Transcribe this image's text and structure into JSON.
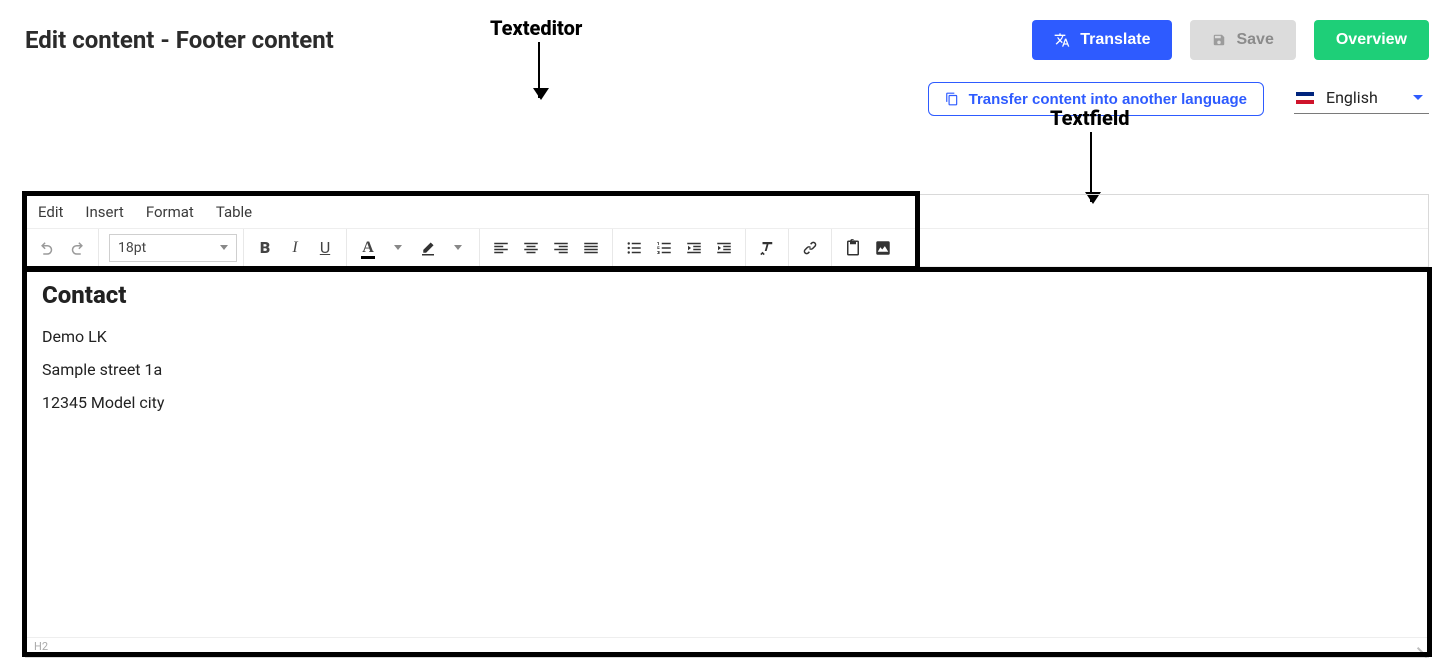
{
  "header": {
    "title": "Edit content - Footer content",
    "translate_label": "Translate",
    "save_label": "Save",
    "overview_label": "Overview"
  },
  "subheader": {
    "transfer_label": "Transfer content into another language",
    "language": "English"
  },
  "annotations": {
    "texteditor": "Texteditor",
    "textfield": "Textfield"
  },
  "editor": {
    "menus": {
      "edit": "Edit",
      "insert": "Insert",
      "format": "Format",
      "table": "Table"
    },
    "font_size": "18pt",
    "statusbar_path": "H2"
  },
  "content": {
    "heading": "Contact",
    "lines": [
      "Demo LK",
      "Sample street 1a",
      "12345 Model city"
    ]
  }
}
